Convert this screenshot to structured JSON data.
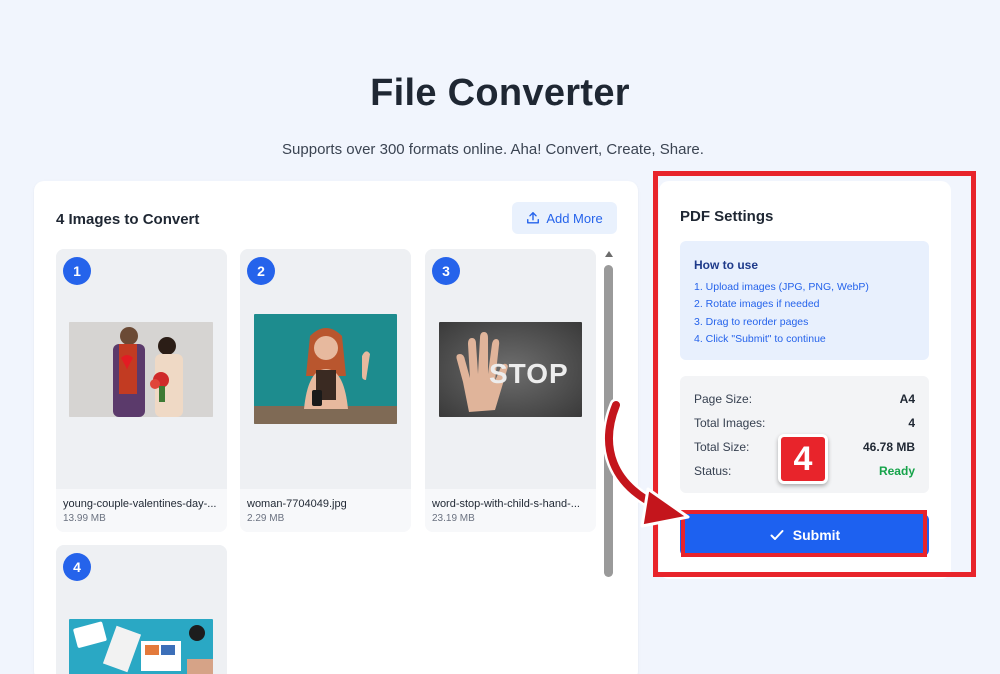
{
  "header": {
    "title": "File Converter",
    "subtitle": "Supports over 300 formats online. Aha! Convert, Create, Share."
  },
  "images_panel": {
    "heading": "4 Images to Convert",
    "add_more_label": "Add More",
    "items": [
      {
        "index": "1",
        "file_name": "young-couple-valentines-day-...",
        "file_size": "13.99 MB"
      },
      {
        "index": "2",
        "file_name": "woman-7704049.jpg",
        "file_size": "2.29 MB"
      },
      {
        "index": "3",
        "file_name": "word-stop-with-child-s-hand-...",
        "file_size": "23.19 MB"
      },
      {
        "index": "4",
        "file_name": "",
        "file_size": ""
      }
    ],
    "stop_sign_text": "STOP"
  },
  "settings_panel": {
    "title": "PDF Settings",
    "how_to": {
      "title": "How to use",
      "steps": [
        "1. Upload images (JPG, PNG, WebP)",
        "2. Rotate images if needed",
        "3. Drag to reorder pages",
        "4. Click \"Submit\" to continue"
      ]
    },
    "summary": {
      "page_size_label": "Page Size:",
      "page_size_value": "A4",
      "total_images_label": "Total Images:",
      "total_images_value": "4",
      "total_size_label": "Total Size:",
      "total_size_value": "46.78 MB",
      "status_label": "Status:",
      "status_value": "Ready"
    },
    "submit_label": "Submit"
  },
  "annotation": {
    "step_number": "4"
  },
  "colors": {
    "accent": "#2563eb",
    "submit": "#1d61f0",
    "annotation_red": "#e8242b",
    "ready_green": "#16a34a",
    "background": "#f1f5fd"
  },
  "icons": {
    "add_more": "upload-icon",
    "submit": "checkmark-icon"
  }
}
